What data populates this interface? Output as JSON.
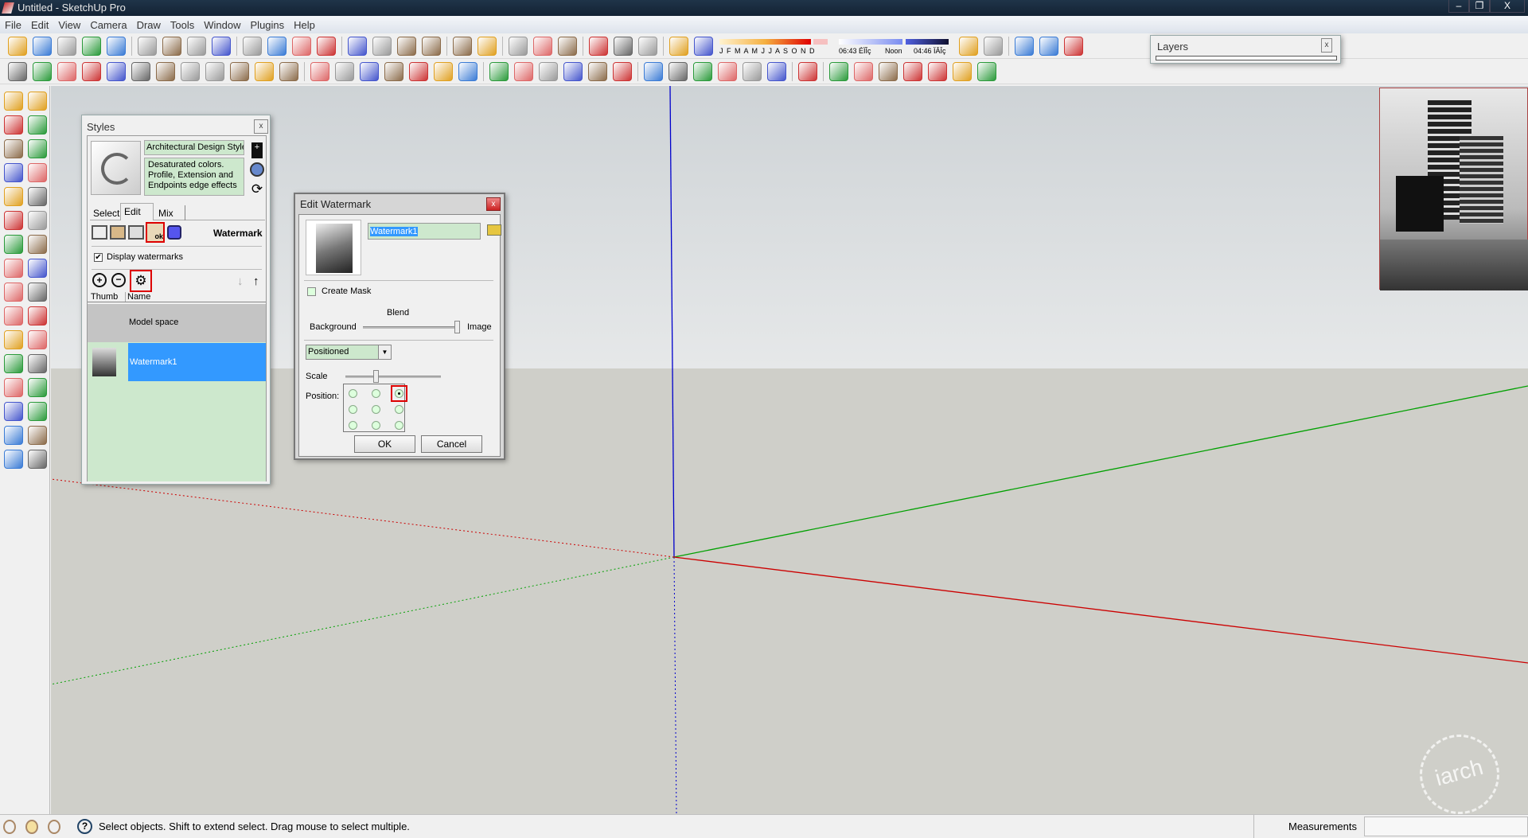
{
  "window": {
    "title": "Untitled - SketchUp Pro",
    "controls": [
      "minimize",
      "restore",
      "close"
    ]
  },
  "menu": [
    "File",
    "Edit",
    "View",
    "Camera",
    "Draw",
    "Tools",
    "Window",
    "Plugins",
    "Help"
  ],
  "toolbar_row1": [
    "select-icon",
    "pencil-icon",
    "rectangle-icon",
    "circle-icon",
    "arc-icon",
    "|",
    "make-component-icon",
    "eraser-icon",
    "tape-measure-icon",
    "paint-bucket-icon",
    "|",
    "push-pull-icon",
    "move-icon",
    "rotate-icon",
    "follow-me-icon",
    "|",
    "orbit-icon",
    "pan-icon",
    "zoom-icon",
    "zoom-extents-icon",
    "|",
    "get-models-icon",
    "share-model-icon",
    "|",
    "photo-textures-icon",
    "add-location-icon",
    "toggle-terrain-icon",
    "|",
    "get-component-icon",
    "share-component-icon",
    "share-3d-icon",
    "|",
    "model-info-icon",
    "shadow-settings-icon"
  ],
  "shadow_toolbar": {
    "months": "J F M A M J J A S O N D",
    "time_start": "06:43 ÉÏÎç",
    "time_mid": "Noon",
    "time_end": "04:46 ÏÂÎç"
  },
  "toolbar_row1b": [
    "sphere-icon",
    "components-icon",
    "|",
    "gear-icon",
    "box-icon",
    "axes-tool-icon"
  ],
  "toolbar_row2": [
    "m-plugin-icon",
    "o-plugin-icon",
    "r-plugin-icon",
    "help-plugin-icon",
    "f-plugin-icon",
    "sphere-small-icon",
    "section-icon",
    "flag-icon",
    "tag-icon",
    "ball-icon",
    "cross-icon",
    "color-wheel-icon",
    "|",
    "tool-a-icon",
    "tool-b-icon",
    "tool-c-icon",
    "tool-d-icon",
    "tool-e-icon",
    "tool-f-icon",
    "tool-g-icon",
    "|",
    "tool-h-icon",
    "tool-i-icon",
    "tool-j-icon",
    "tool-k-icon",
    "tool-l-icon",
    "tool-m-icon",
    "|",
    "tool-n-icon",
    "tool-o-icon",
    "tool-p-icon",
    "tool-q-icon",
    "tool-r-icon",
    "tool-s-icon",
    "|",
    "su-app-icon",
    "|",
    "iso-view-icon",
    "top-view-icon",
    "front-view-icon",
    "right-view-icon",
    "back-view-icon",
    "left-view-icon",
    "bottom-view-icon"
  ],
  "left_toolbar": [
    "select-icon",
    "make-component-icon",
    "paint-bucket-icon",
    "eraser-icon",
    "rectangle-icon",
    "line-icon",
    "circle-icon",
    "arc-icon",
    "polygon-icon",
    "freehand-icon",
    "move-icon",
    "push-pull-icon",
    "rotate-icon",
    "follow-me-icon",
    "scale-icon",
    "offset-icon",
    "tape-measure-icon",
    "dimension-icon",
    "protractor-icon",
    "text-icon",
    "axes-icon",
    "3d-text-icon",
    "orbit-icon",
    "pan-icon",
    "zoom-icon",
    "zoom-window-icon",
    "previous-view-icon",
    "next-view-icon",
    "position-camera-icon",
    "look-around-icon",
    "walk-icon",
    "section-plane-icon"
  ],
  "layers_panel": {
    "title": "Layers"
  },
  "styles_panel": {
    "title": "Styles",
    "style_name": "Architectural Design Style",
    "style_description": "Desaturated colors. Profile, Extension and Endpoints edge effects",
    "tabs": [
      "Select",
      "Edit",
      "Mix"
    ],
    "active_tab": "Edit",
    "section_label": "Watermark",
    "display_watermarks_label": "Display watermarks",
    "display_watermarks_checked": true,
    "columns": [
      "Thumb",
      "Name"
    ],
    "rows": [
      {
        "name": "Model space"
      },
      {
        "name": "Watermark1",
        "selected": true
      }
    ]
  },
  "edit_watermark": {
    "title": "Edit Watermark",
    "name_value": "Watermark1",
    "create_mask_label": "Create Mask",
    "create_mask_checked": false,
    "blend_label": "Blend",
    "blend_left": "Background",
    "blend_right": "Image",
    "blend_value": 1.0,
    "placement": "Positioned",
    "scale_label": "Scale",
    "scale_value": 0.3,
    "position_label": "Position:",
    "position_selected": "top-right",
    "ok": "OK",
    "cancel": "Cancel"
  },
  "status": {
    "hint": "Select objects. Shift to extend select. Drag mouse to select multiple.",
    "measurements_label": "Measurements"
  },
  "colors": {
    "selection": "#3399ff",
    "panel_green": "#cde8cd",
    "highlight_red": "#dd0000",
    "axis_red": "#cc0000",
    "axis_green": "#00a000",
    "axis_blue": "#0000cc"
  }
}
